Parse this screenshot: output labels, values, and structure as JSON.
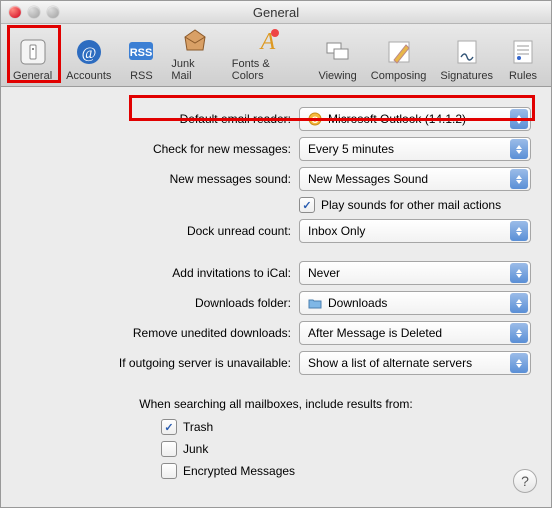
{
  "window": {
    "title": "General"
  },
  "toolbar": {
    "items": [
      {
        "label": "General"
      },
      {
        "label": "Accounts"
      },
      {
        "label": "RSS"
      },
      {
        "label": "Junk Mail"
      },
      {
        "label": "Fonts & Colors"
      },
      {
        "label": "Viewing"
      },
      {
        "label": "Composing"
      },
      {
        "label": "Signatures"
      },
      {
        "label": "Rules"
      }
    ]
  },
  "labels": {
    "default_reader": "Default email reader:",
    "check_messages": "Check for new messages:",
    "sound": "New messages sound:",
    "play_sounds": "Play sounds for other mail actions",
    "dock": "Dock unread count:",
    "ical": "Add invitations to iCal:",
    "downloads": "Downloads folder:",
    "remove": "Remove unedited downloads:",
    "outgoing": "If outgoing server is unavailable:",
    "search_header": "When searching all mailboxes, include results from:",
    "trash": "Trash",
    "junk": "Junk",
    "encrypted": "Encrypted Messages"
  },
  "values": {
    "default_reader": "Microsoft Outlook (14.1.2)",
    "check_messages": "Every 5 minutes",
    "sound": "New Messages Sound",
    "dock": "Inbox Only",
    "ical": "Never",
    "downloads": "Downloads",
    "remove": "After Message is Deleted",
    "outgoing": "Show a list of alternate servers"
  },
  "checks": {
    "play_sounds": true,
    "trash": true,
    "junk": false,
    "encrypted": false
  },
  "help": "?"
}
